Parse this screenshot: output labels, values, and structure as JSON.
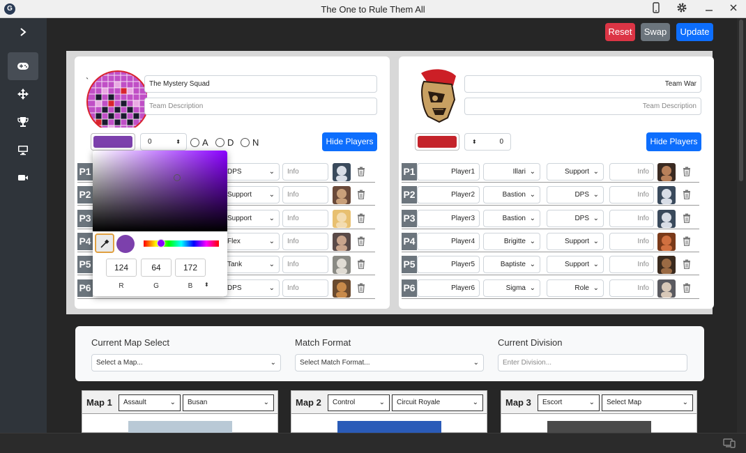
{
  "window": {
    "title": "The One to Rule Them All"
  },
  "actions": {
    "reset": "Reset",
    "swap": "Swap",
    "update": "Update"
  },
  "team1": {
    "name": "The Mystery Squad",
    "description_placeholder": "Team Description",
    "color": "#7c40ac",
    "score": "0",
    "side_options": [
      "A",
      "D",
      "N"
    ],
    "hide_players": "Hide Players",
    "players": [
      {
        "badge": "P1",
        "role": "DPS",
        "info": "Info"
      },
      {
        "badge": "P2",
        "role": "Support",
        "info": "Info"
      },
      {
        "badge": "P3",
        "role": "Support",
        "info": "Info"
      },
      {
        "badge": "P4",
        "role": "Flex",
        "info": "Info"
      },
      {
        "badge": "P5",
        "role": "Tank",
        "info": "Info"
      },
      {
        "badge": "P6",
        "role": "DPS",
        "info": "Info"
      }
    ]
  },
  "team2": {
    "name": "Team War",
    "description_placeholder": "Team Description",
    "color": "#c4232a",
    "score": "0",
    "hide_players": "Hide Players",
    "players": [
      {
        "badge": "P1",
        "name": "Player1",
        "hero": "Illari",
        "role": "Support",
        "info": "Info"
      },
      {
        "badge": "P2",
        "name": "Player2",
        "hero": "Bastion",
        "role": "DPS",
        "info": "Info"
      },
      {
        "badge": "P3",
        "name": "Player3",
        "hero": "Bastion",
        "role": "DPS",
        "info": "Info"
      },
      {
        "badge": "P4",
        "name": "Player4",
        "hero": "Brigitte",
        "role": "Support",
        "info": "Info"
      },
      {
        "badge": "P5",
        "name": "Player5",
        "hero": "Baptiste",
        "role": "Support",
        "info": "Info"
      },
      {
        "badge": "P6",
        "name": "Player6",
        "hero": "Sigma",
        "role": "Role",
        "info": "Info"
      }
    ]
  },
  "color_picker": {
    "r": "124",
    "g": "64",
    "b": "172",
    "r_label": "R",
    "g_label": "G",
    "b_label": "B"
  },
  "match": {
    "map_label": "Current Map Select",
    "map_placeholder": "Select a Map...",
    "format_label": "Match Format",
    "format_placeholder": "Select Match Format...",
    "division_label": "Current Division",
    "division_placeholder": "Enter Division..."
  },
  "maps": [
    {
      "title": "Map 1",
      "mode": "Assault",
      "map": "Busan"
    },
    {
      "title": "Map 2",
      "mode": "Control",
      "map": "Circuit Royale"
    },
    {
      "title": "Map 3",
      "mode": "Escort",
      "map": "Select Map"
    }
  ],
  "icons": [
    "chevron-right-icon",
    "gamepad-icon",
    "arrows-move-icon",
    "trophy-icon",
    "monitor-icon",
    "camera-icon",
    "phone-icon",
    "gear-icon",
    "minimize-icon",
    "close-icon",
    "trash-icon",
    "eyedropper-icon",
    "devices-icon"
  ]
}
